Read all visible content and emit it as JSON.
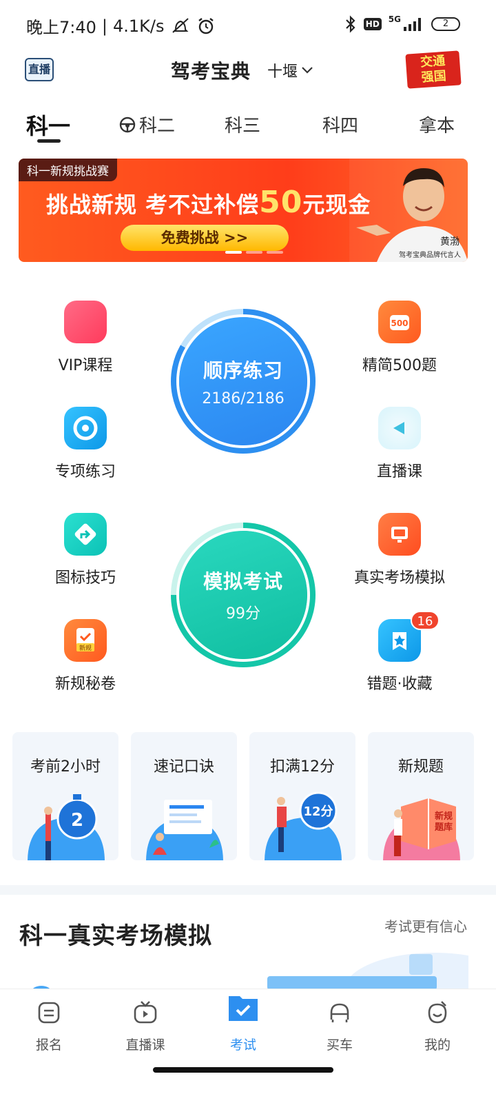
{
  "status_bar": {
    "time": "晚上7:40",
    "speed": "4.1K/s",
    "network": "5G",
    "hd": "HD",
    "battery": "2"
  },
  "header": {
    "live_badge": "直播",
    "app_title": "驾考宝典",
    "city": "十堰",
    "seal_text": "交通强国"
  },
  "tabs": [
    {
      "label": "科一",
      "active": true
    },
    {
      "label": "科二",
      "active": false
    },
    {
      "label": "科三",
      "active": false
    },
    {
      "label": "科四",
      "active": false
    },
    {
      "label": "拿本",
      "active": false
    }
  ],
  "banner": {
    "tag": "科一新规挑战赛",
    "headline_pre": "挑战新规 考不过补偿",
    "headline_amount": "50",
    "headline_post": "元现金",
    "cta": "免费挑战 >>",
    "person_name": "黄渤",
    "person_sub": "驾考宝典品牌代言人",
    "page_count": 3,
    "current_page": 1
  },
  "features_left": [
    {
      "label": "VIP课程",
      "icon": "vip-course-icon",
      "color": "#ff4d6d"
    },
    {
      "label": "专项练习",
      "icon": "target-icon",
      "color": "#15a9ee"
    },
    {
      "label": "图标技巧",
      "icon": "sign-arrow-icon",
      "color": "#14d3c2"
    },
    {
      "label": "新规秘卷",
      "icon": "new-rules-paper-icon",
      "color": "#ff6a2a"
    }
  ],
  "features_right": [
    {
      "label": "精简500题",
      "icon": "500-questions-icon",
      "color": "#ff6a2a"
    },
    {
      "label": "直播课",
      "icon": "play-icon",
      "color": "#3ed0e8"
    },
    {
      "label": "真实考场模拟",
      "icon": "monitor-icon",
      "color": "#ff5a2a"
    },
    {
      "label": "错题·收藏",
      "icon": "star-bookmark-icon",
      "color": "#15a9ee",
      "badge": "16"
    }
  ],
  "practice": {
    "title": "顺序练习",
    "progress": "2186/2186",
    "progress_fraction": 1.0,
    "color": "#2d8ff0"
  },
  "mock_exam": {
    "title": "模拟考试",
    "score": "99分",
    "color": "#14c6a8"
  },
  "cards": [
    {
      "title": "考前2小时",
      "art_text": "2"
    },
    {
      "title": "速记口诀",
      "art_text": ""
    },
    {
      "title": "扣满12分",
      "art_text": "12分"
    },
    {
      "title": "新规题",
      "art_text": "新规\n题库"
    }
  ],
  "section": {
    "title": "科一真实考场模拟",
    "subtitle": "考试更有信心"
  },
  "bottom_nav": [
    {
      "label": "报名",
      "icon": "signup-icon",
      "active": false
    },
    {
      "label": "直播课",
      "icon": "tv-icon",
      "active": false
    },
    {
      "label": "考试",
      "icon": "exam-folder-icon",
      "active": true
    },
    {
      "label": "买车",
      "icon": "car-icon",
      "active": false
    },
    {
      "label": "我的",
      "icon": "profile-icon",
      "active": false
    }
  ]
}
